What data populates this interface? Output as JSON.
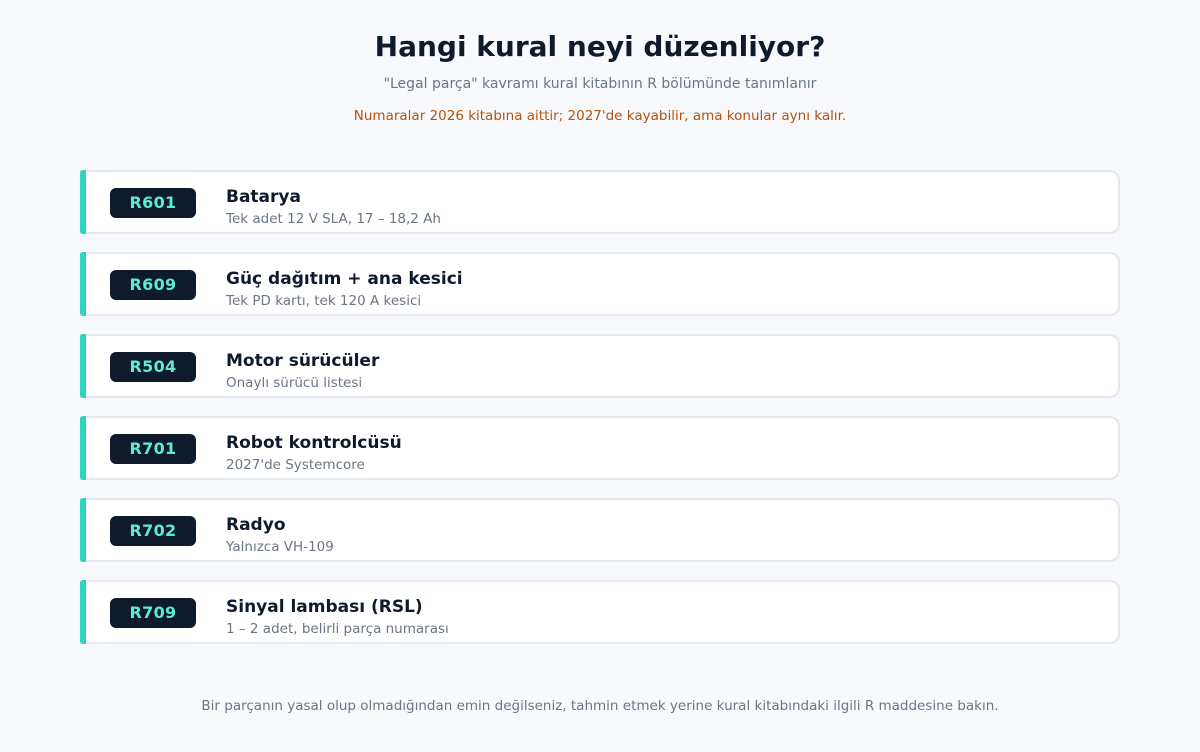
{
  "header": {
    "title": "Hangi kural neyi düzenliyor?",
    "subtitle": "\"Legal parça\" kavramı kural kitabının R bölümünde tanımlanır",
    "note": "Numaralar 2026 kitabına aittir; 2027'de kayabilir, ama konular aynı kalır."
  },
  "rules": [
    {
      "code": "R601",
      "name": "Batarya",
      "desc": "Tek adet 12 V SLA, 17 – 18,2 Ah"
    },
    {
      "code": "R609",
      "name": "Güç dağıtım + ana kesici",
      "desc": "Tek PD kartı, tek 120 A kesici"
    },
    {
      "code": "R504",
      "name": "Motor sürücüler",
      "desc": "Onaylı sürücü listesi"
    },
    {
      "code": "R701",
      "name": "Robot kontrolcüsü",
      "desc": "2027'de Systemcore"
    },
    {
      "code": "R702",
      "name": "Radyo",
      "desc": "Yalnızca VH-109"
    },
    {
      "code": "R709",
      "name": "Sinyal lambası (RSL)",
      "desc": "1 – 2 adet, belirli parça numarası"
    }
  ],
  "footer": {
    "text": "Bir parçanın yasal olup olmadığından emin değilseniz, tahmin etmek yerine kural kitabındaki ilgili R maddesine bakın."
  },
  "colors": {
    "accent": "#2dd4bf",
    "badge_bg": "#0f1b2d",
    "badge_text": "#5eead4",
    "note": "#b45309"
  }
}
